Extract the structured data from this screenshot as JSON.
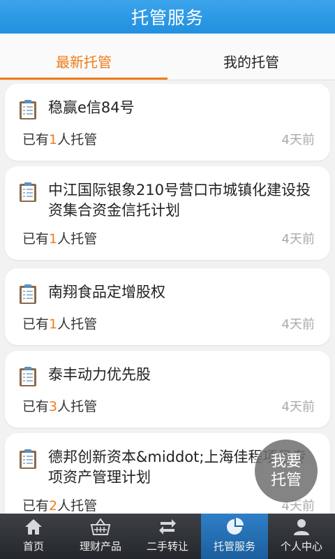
{
  "header": {
    "title": "托管服务"
  },
  "tabs": [
    {
      "label": "最新托管",
      "active": true
    },
    {
      "label": "我的托管",
      "active": false
    }
  ],
  "cards": [
    {
      "title": "稳赢e信84号",
      "prefix": "已有",
      "count": "1",
      "suffix": "人托管",
      "time": "4天前"
    },
    {
      "title": "中江国际银象210号营口市城镇化建设投资集合资金信托计划",
      "prefix": "已有",
      "count": "1",
      "suffix": "人托管",
      "time": "4天前"
    },
    {
      "title": "南翔食品定增股权",
      "prefix": "已有",
      "count": "1",
      "suffix": "人托管",
      "time": "4天前"
    },
    {
      "title": "泰丰动力优先股",
      "prefix": "已有",
      "count": "3",
      "suffix": "人托管",
      "time": "4天前"
    },
    {
      "title": "德邦创新资本&middot;上海佳程项目专项资产管理计划",
      "prefix": "已有",
      "count": "2",
      "suffix": "人托管",
      "time": "4天前"
    }
  ],
  "fab": {
    "line1": "我要",
    "line2": "托管"
  },
  "nav": [
    {
      "label": "首页",
      "icon": "home-icon"
    },
    {
      "label": "理财产品",
      "icon": "basket-icon"
    },
    {
      "label": "二手转让",
      "icon": "transfer-icon"
    },
    {
      "label": "托管服务",
      "icon": "pie-chart-icon",
      "active": true
    },
    {
      "label": "个人中心",
      "icon": "user-icon"
    }
  ],
  "colors": {
    "header": "#2190df",
    "accent": "#f07b1a",
    "nav_bg": "#2b2e32",
    "nav_active": "#2070b5"
  }
}
